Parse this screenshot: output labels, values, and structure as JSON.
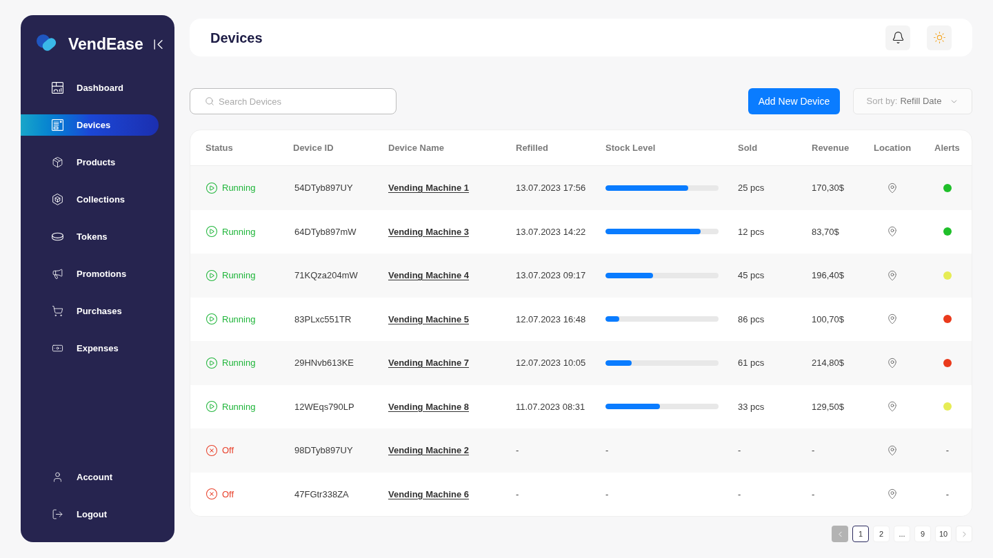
{
  "sidebar": {
    "brand": "VendEase",
    "items": [
      {
        "label": "Dashboard",
        "selected": false
      },
      {
        "label": "Devices",
        "selected": true
      },
      {
        "label": "Products",
        "selected": false
      },
      {
        "label": "Collections",
        "selected": false
      },
      {
        "label": "Tokens",
        "selected": false
      },
      {
        "label": "Promotions",
        "selected": false
      },
      {
        "label": "Purchases",
        "selected": false
      },
      {
        "label": "Expenses",
        "selected": false
      }
    ],
    "footer_items": [
      {
        "label": "Account"
      },
      {
        "label": "Logout"
      }
    ]
  },
  "header": {
    "title": "Devices"
  },
  "toolbar": {
    "search": {
      "placeholder": "Search Devices"
    },
    "add_button": "Add New Device",
    "sort": {
      "label": "Sort by:",
      "value": "Refill Date"
    }
  },
  "table": {
    "columns": [
      "Status",
      "Device ID",
      "Device Name",
      "Refilled",
      "Stock Level",
      "Sold",
      "Revenue",
      "Location",
      "Alerts"
    ],
    "rows": [
      {
        "status": {
          "kind": "running",
          "label": "Running"
        },
        "device_id": "54DTyb897UY",
        "device_name": "Vending Machine 1",
        "refilled": "13.07.2023 17:56",
        "stock": {
          "kind": "bar",
          "level": 0.73
        },
        "sold": "25 pcs",
        "revenue": "170,30$",
        "alert": {
          "kind": "dot",
          "color": "#1fbf2a"
        }
      },
      {
        "status": {
          "kind": "running",
          "label": "Running"
        },
        "device_id": "64DTyb897mW",
        "device_name": "Vending Machine 3",
        "refilled": "13.07.2023 14:22",
        "stock": {
          "kind": "bar",
          "level": 0.84
        },
        "sold": "12 pcs",
        "revenue": "83,70$",
        "alert": {
          "kind": "dot",
          "color": "#1fbf2a"
        }
      },
      {
        "status": {
          "kind": "running",
          "label": "Running"
        },
        "device_id": "71KQza204mW",
        "device_name": "Vending Machine 4",
        "refilled": "13.07.2023 09:17",
        "stock": {
          "kind": "bar",
          "level": 0.42
        },
        "sold": "45 pcs",
        "revenue": "196,40$",
        "alert": {
          "kind": "dot",
          "color": "#e6ec55"
        }
      },
      {
        "status": {
          "kind": "running",
          "label": "Running"
        },
        "device_id": "83PLxc551TR",
        "device_name": "Vending Machine 5",
        "refilled": "12.07.2023 16:48",
        "stock": {
          "kind": "bar",
          "level": 0.12
        },
        "sold": "86 pcs",
        "revenue": "100,70$",
        "alert": {
          "kind": "dot",
          "color": "#ea3a1c"
        }
      },
      {
        "status": {
          "kind": "running",
          "label": "Running"
        },
        "device_id": "29HNvb613KE",
        "device_name": "Vending Machine 7",
        "refilled": "12.07.2023 10:05",
        "stock": {
          "kind": "bar",
          "level": 0.23
        },
        "sold": "61 pcs",
        "revenue": "214,80$",
        "alert": {
          "kind": "dot",
          "color": "#ea3a1c"
        }
      },
      {
        "status": {
          "kind": "running",
          "label": "Running"
        },
        "device_id": "12WEqs790LP",
        "device_name": "Vending Machine 8",
        "refilled": "11.07.2023 08:31",
        "stock": {
          "kind": "bar",
          "level": 0.48
        },
        "sold": "33 pcs",
        "revenue": "129,50$",
        "alert": {
          "kind": "dot",
          "color": "#e6ec55"
        }
      },
      {
        "status": {
          "kind": "off",
          "label": "Off"
        },
        "device_id": "98DTyb897UY",
        "device_name": "Vending Machine 2",
        "refilled": "-",
        "stock": {
          "kind": "text",
          "text": "-"
        },
        "sold": "-",
        "revenue": "-",
        "alert": {
          "kind": "text",
          "text": "-"
        }
      },
      {
        "status": {
          "kind": "off",
          "label": "Off"
        },
        "device_id": "47FGtr338ZA",
        "device_name": "Vending Machine 6",
        "refilled": "-",
        "stock": {
          "kind": "text",
          "text": "-"
        },
        "sold": "-",
        "revenue": "-",
        "alert": {
          "kind": "text",
          "text": "-"
        }
      }
    ]
  },
  "pagination": {
    "prev": {
      "disabled": true
    },
    "pages": [
      {
        "label": "1",
        "selected": true
      },
      {
        "label": "2",
        "selected": false
      },
      {
        "label": "...",
        "selected": false
      },
      {
        "label": "9",
        "selected": false
      },
      {
        "label": "10",
        "selected": false
      }
    ],
    "next": {
      "disabled": false
    }
  }
}
